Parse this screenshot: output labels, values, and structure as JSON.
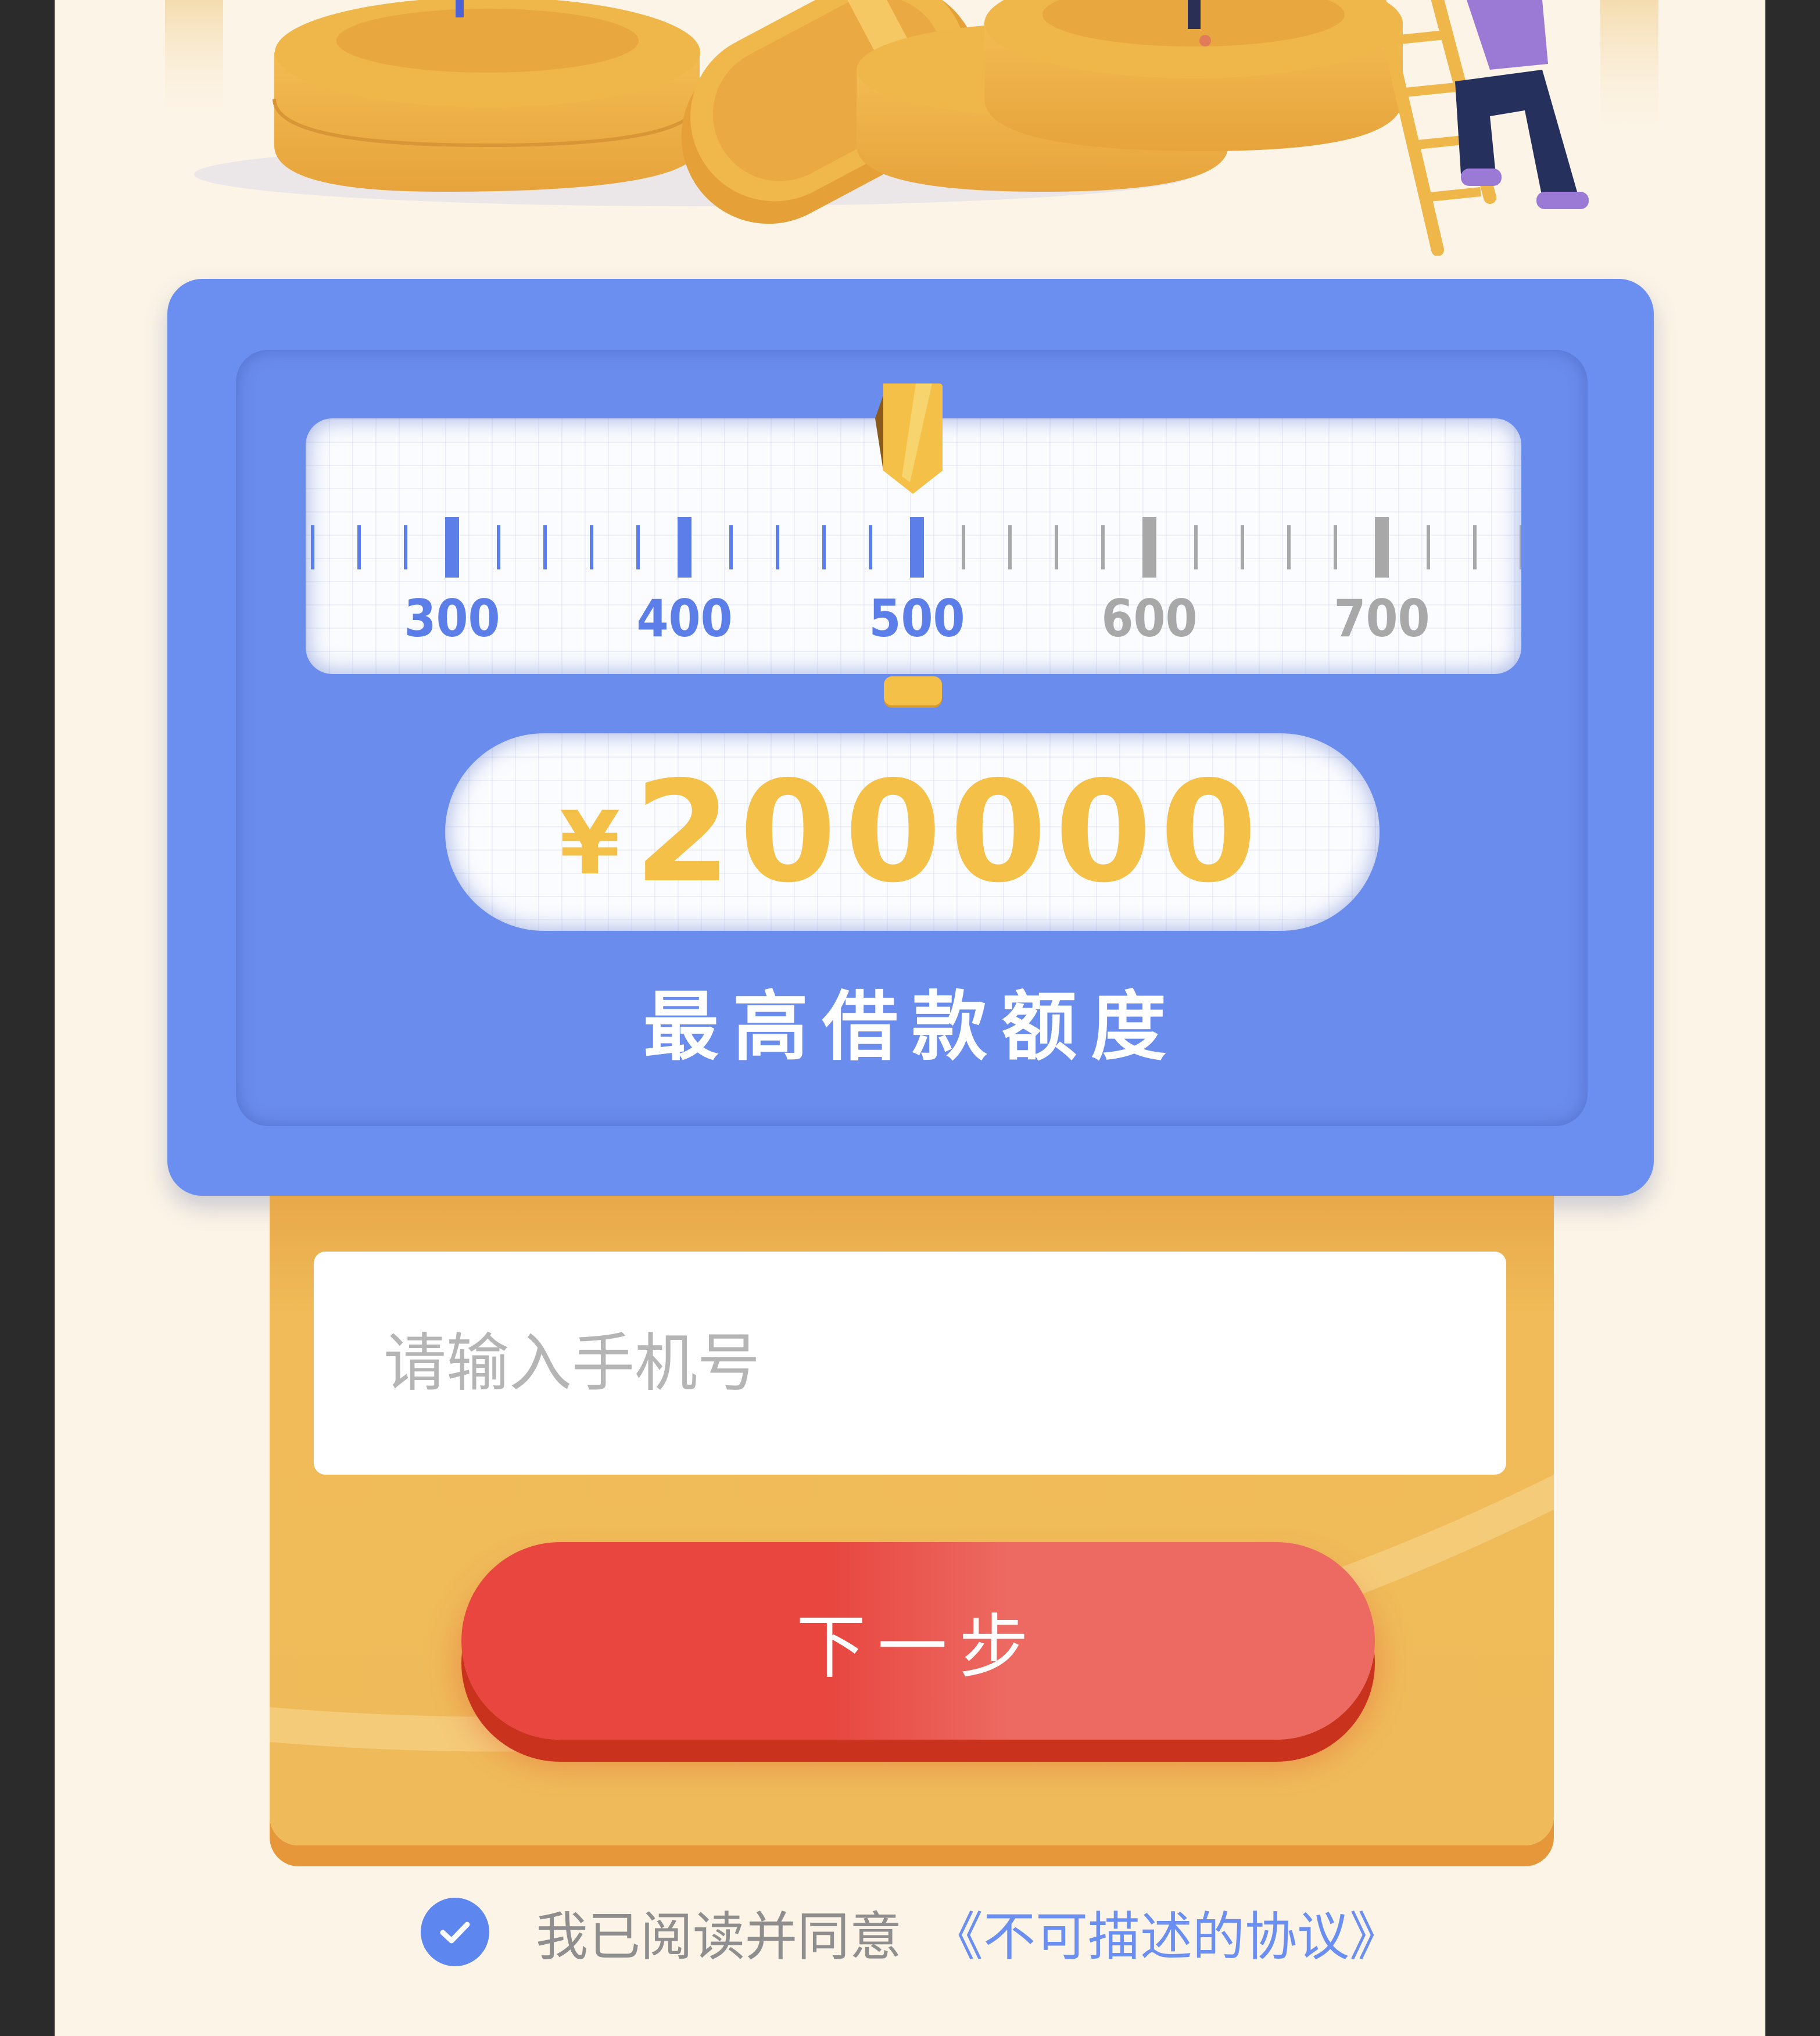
{
  "theme": {
    "page_bg": "#fcf4e6",
    "card_blue": "#6b8ff0",
    "accent_yellow": "#f4c048",
    "button_red": "#e8463f",
    "ruler_active": "#5b7ee8",
    "ruler_inactive": "#a8a8a8"
  },
  "ruler": {
    "labels": [
      "300",
      "400",
      "500",
      "600",
      "700"
    ],
    "selected": "500"
  },
  "amount": {
    "currency": "¥",
    "value": "200000",
    "caption": "最高借款额度"
  },
  "form": {
    "phone_placeholder": "请输入手机号",
    "next_label": "下一步"
  },
  "agreement": {
    "checked": true,
    "text": "我已阅读并同意",
    "link": "《不可描述的协议》"
  },
  "icons": {
    "check": "check-circle-icon",
    "slider": "slider-pointer-icon"
  }
}
